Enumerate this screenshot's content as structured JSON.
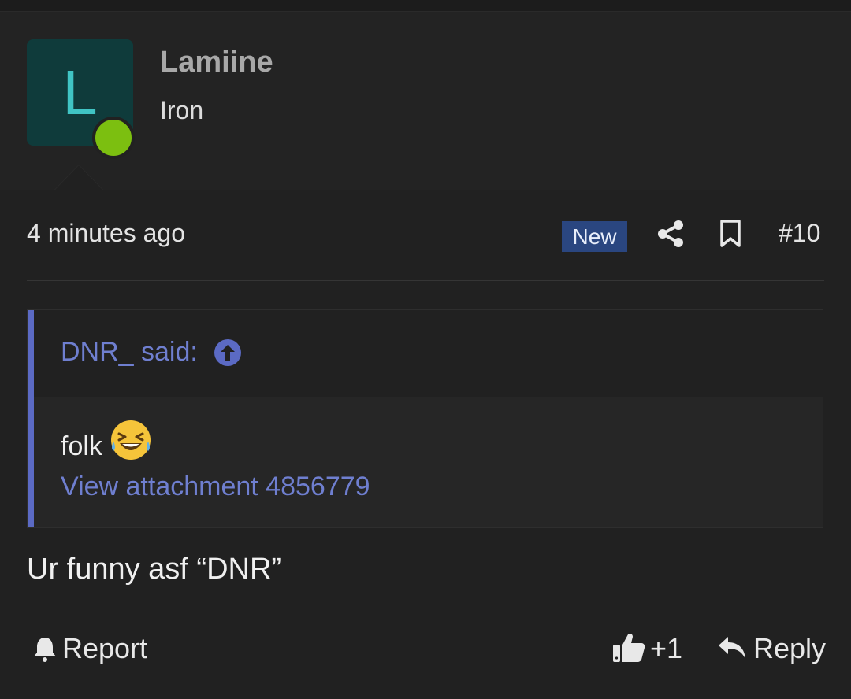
{
  "user": {
    "avatar_letter": "L",
    "name": "Lamiine",
    "title": "Iron",
    "online_color": "#7cbf10",
    "avatar_bg": "#0f3b3b"
  },
  "meta": {
    "timestamp": "4 minutes ago",
    "badge": "New",
    "post_number": "#10",
    "icons": [
      "share-icon",
      "bookmark-icon"
    ]
  },
  "quote": {
    "author": "DNR_ said:",
    "body_text": "folk",
    "emoji": "grinning-squinting-tears-face",
    "attachment_link": "View attachment 4856779"
  },
  "message": "Ur funny asf “DNR”",
  "actions": {
    "report": "Report",
    "likes": "+1",
    "reply": "Reply"
  },
  "colors": {
    "background": "#212121",
    "accent_link": "#6f7fd0",
    "badge_bg": "#2a4680",
    "quote_bar": "#5b6ac4"
  }
}
